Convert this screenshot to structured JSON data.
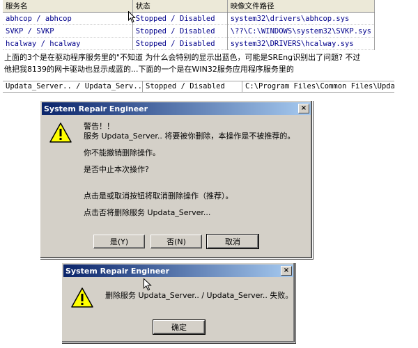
{
  "table": {
    "headers": [
      "服务名",
      "状态",
      "映像文件路径"
    ],
    "rows": [
      [
        "abhcop / abhcop",
        "Stopped / Disabled",
        "system32\\drivers\\abhcop.sys"
      ],
      [
        "SVKP / SVKP",
        "Stopped / Disabled",
        "\\??\\C:\\WINDOWS\\system32\\SVKP.sys"
      ],
      [
        "hcalway / hcalway",
        "Stopped / Disabled",
        "system32\\DRIVERS\\hcalway.sys"
      ]
    ]
  },
  "note": {
    "line1": "上面的3个是在驱动程序服务里的\"不知道 为什么会特别的显示出蓝色，可能是SREng识别出了问题? 不过",
    "line2": "他把我8139的网卡驱动也显示成蓝的...下面的一个是在WIN32服务应用程序服务里的"
  },
  "row2": [
    "Updata_Server.. / Updata_Serv...",
    "Stopped / Disabled",
    "C:\\Program Files\\Common Files\\Update"
  ],
  "dialog1": {
    "title": "System Repair Engineer",
    "close": "×",
    "l1": "警告！！",
    "l2": "服务 Updata_Server.. 将要被你删除，本操作是不被推荐的。",
    "l3": "你不能撤销删除操作。",
    "l4": "是否中止本次操作?",
    "l5": "点击是或取消按钮将取消删除操作（推荐）。",
    "l6": "点击否将删除服务 Updata_Server...",
    "yes": "是(Y)",
    "no": "否(N)",
    "cancel": "取消"
  },
  "dialog2": {
    "title": "System Repair Engineer",
    "close": "×",
    "msg": "删除服务 Updata_Server.. / Updata_Server.. 失败。",
    "ok": "确定"
  },
  "icons": {
    "warning": "warning-icon",
    "cursor": "mouse-cursor-icon"
  }
}
